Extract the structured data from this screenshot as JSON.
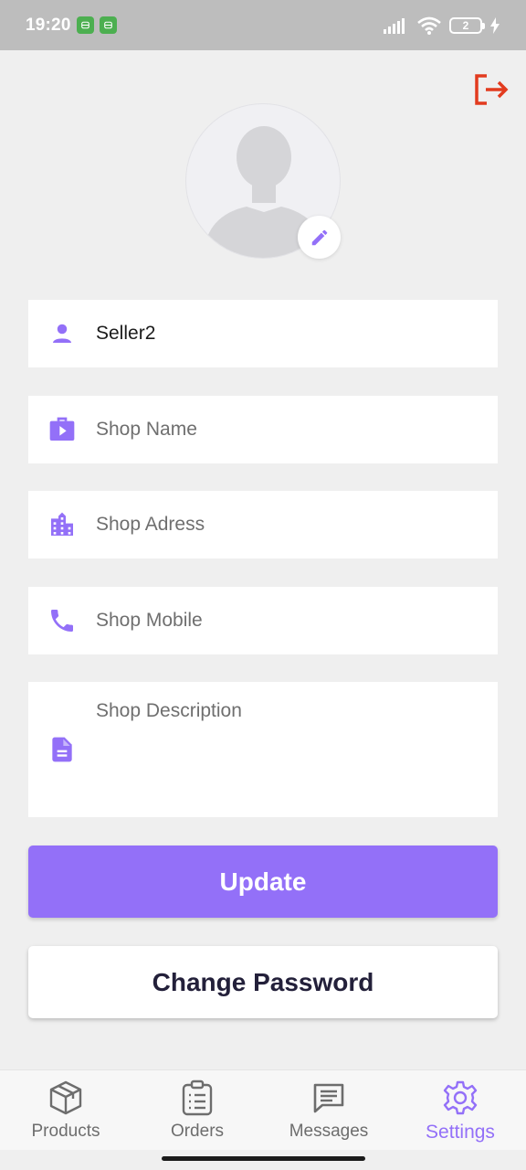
{
  "status_bar": {
    "time": "19:20",
    "battery": "2"
  },
  "colors": {
    "accent": "#9370f8",
    "logout": "#e23b1f"
  },
  "form": {
    "name": {
      "value": "Seller2",
      "placeholder": ""
    },
    "shop_name": {
      "value": "",
      "placeholder": "Shop Name"
    },
    "shop_address": {
      "value": "",
      "placeholder": "Shop Adress"
    },
    "shop_mobile": {
      "value": "",
      "placeholder": "Shop Mobile"
    },
    "shop_description": {
      "value": "",
      "placeholder": "Shop Description"
    }
  },
  "buttons": {
    "update": "Update",
    "change_password": "Change Password"
  },
  "nav": {
    "products": "Products",
    "orders": "Orders",
    "messages": "Messages",
    "settings": "Settings"
  }
}
